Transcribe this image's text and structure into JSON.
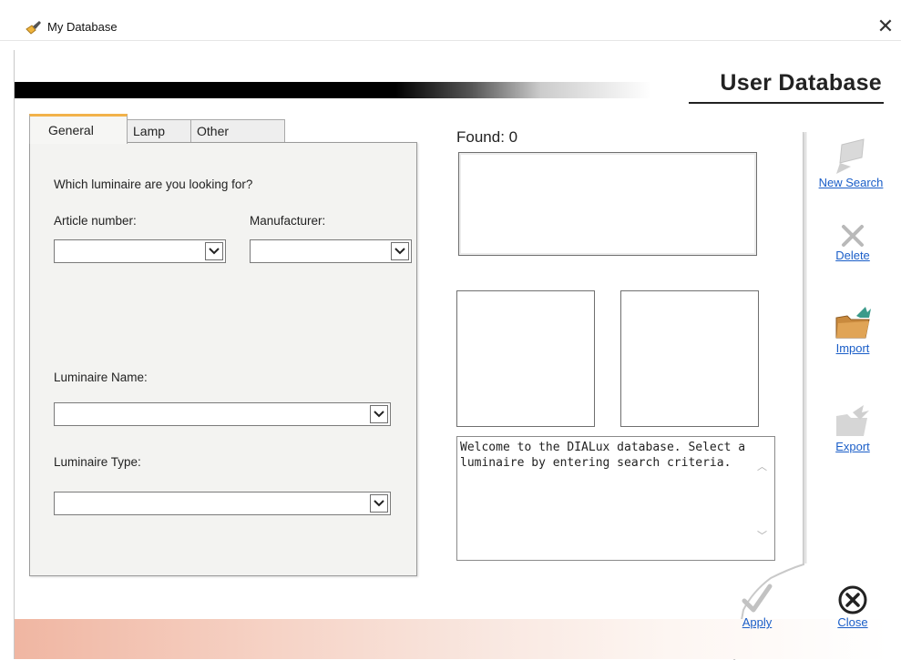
{
  "window": {
    "title": "My Database",
    "close_glyph": "✕"
  },
  "header": {
    "title": "User Database"
  },
  "tabs": [
    {
      "label": "General",
      "active": true
    },
    {
      "label": "Lamp",
      "active": false
    },
    {
      "label": "Other",
      "active": false
    }
  ],
  "general": {
    "question": "Which luminaire are you looking for?",
    "article_label": "Article number:",
    "manufacturer_label": "Manufacturer:",
    "name_label": "Luminaire Name:",
    "type_label": "Luminaire Type:"
  },
  "results": {
    "found_label": "Found: 0",
    "message": "Welcome to the DIALux database. Select a luminaire by entering search criteria."
  },
  "actions": {
    "new_search": "New Search",
    "delete": "Delete",
    "import": "Import",
    "export": "Export",
    "apply": "Apply",
    "close": "Close"
  },
  "icons": {
    "app": "flashlight-icon",
    "new_search": "page-icon",
    "delete": "x-icon",
    "import": "folder-arrow-icon",
    "export": "folder-out-icon",
    "apply": "checkmark-icon",
    "close": "circle-x-icon"
  },
  "colors": {
    "link": "#1a5ec8",
    "tab_accent": "#f2b24a"
  }
}
